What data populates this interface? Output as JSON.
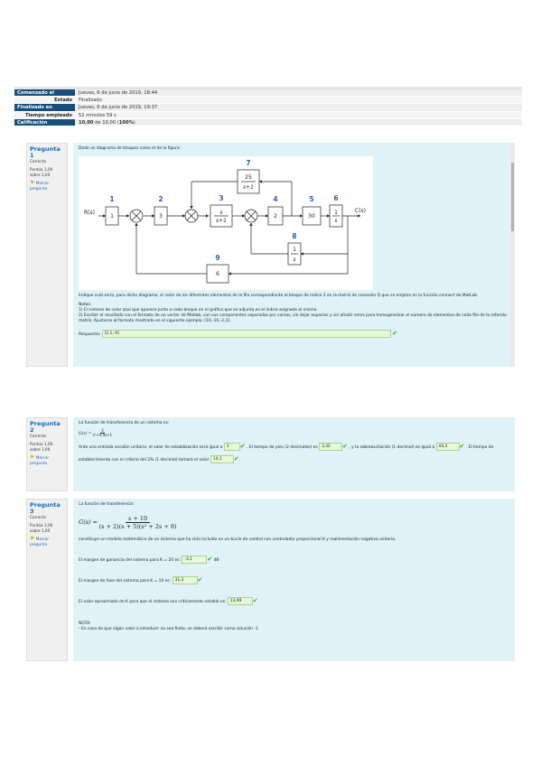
{
  "summary": [
    {
      "label": "Comenzado el",
      "value": "Jueves, 6 de junio de 2019, 18:44"
    },
    {
      "label": "Estado",
      "value": "Finalizado"
    },
    {
      "label": "Finalizado en",
      "value": "Jueves, 6 de junio de 2019, 19:37"
    },
    {
      "label": "Tiempo empleado",
      "value": "52 minutos 59 s"
    },
    {
      "label": "Calificación",
      "value_bold": "10,00",
      "value_mid": " de 10,00 (",
      "value_pct": "100%",
      "value_end": ")"
    }
  ],
  "q1": {
    "label": "Pregunta",
    "num": "1",
    "status": "Correcta",
    "score": "Puntúa 1,00 sobre 1,00",
    "flag": "Marcar pregunta",
    "intro": "Dado un diagrama de bloques como el de la figura:",
    "diagram": {
      "index_labels": [
        "1",
        "2",
        "3",
        "4",
        "5",
        "6",
        "7",
        "8",
        "9"
      ],
      "blocks": {
        "b1": "1",
        "b2": "3",
        "b3_num": "s",
        "b3_den": "s+1",
        "b4": "2",
        "b5": "30",
        "b6_num": "1",
        "b6_den": "s",
        "b7_num": "25",
        "b7_den": "s+1",
        "b8_num": "1",
        "b8_den": "s",
        "b9": "6"
      },
      "input": "R(s)",
      "output": "C(s)"
    },
    "para1": "Indique cuál sería, para dicho diagrama, el valor de los diferentes elementos de la fila correspondiente al bloque de índice 2 en la matriz de conexión Q que se emplea en la función",
    "para1_em": "connect",
    "para1_end": "de MatLab.",
    "notes_title": "Notas:",
    "note1": "1) El número de color azul que aparece junto a cada bloque en el gráfico que se adjunta es el índice asignado al mismo.",
    "note2": "2) Escribir el resultado con el formato de un vector de Matlab, con sus componentes separadas por comas, sin dejar espacios y sin añadir ceros para homogeneizar el número de elementos de cada fila de la referida matriz. Ajustarse al formato mostrado en el siguiente ejemplo: [10,-10,-2,3].",
    "answer_label": "Respuesta:",
    "answer": "[2,1,-9]"
  },
  "q2": {
    "label": "Pregunta",
    "num": "2",
    "status": "Correcta",
    "score": "Puntúa 1,00 sobre 1,00",
    "flag": "Marcar pregunta",
    "intro": "La función de transferencia de un sistema es:",
    "tf_lhs": "G(s) =",
    "tf_num": "3",
    "tf_den": "s²+4.4s+1",
    "t1": "Ante una entrada escalón unitario, el valor de estabilización será igual a",
    "a1": "3",
    "t2": ". El tiempo de pico (2 decimales) es",
    "a2": "3,32",
    "t3": ", y la sobreoscilación (1 decimal) es igual a",
    "a3": "44,3",
    "t4": ". El tiempo de establecimiento con el criterio del 2% (1 decimal) tomará el valor",
    "a4": "14,1",
    "t5": "."
  },
  "q3": {
    "label": "Pregunta",
    "num": "3",
    "status": "Correcta",
    "score": "Puntúa 1,00 sobre 1,00",
    "flag": "Marcar pregunta",
    "intro": "La función de transferencia:",
    "tf_lhs": "G(s) =",
    "tf_num": "s + 10",
    "tf_den": "(s + 2)(s + 5)(s² + 2s + 8)",
    "desc": "constituye un modelo matemático de un sistema que ha sido incluido en un bucle de control con controlador proporcional K y realimentación negativa unitaria.",
    "p1": "El margen de ganancia del sistema para K = 20 es:",
    "a1": "-3,1",
    "u1": "dB",
    "p2": "El margen de fase del sistema para K = 10 es:",
    "a2": "31,3",
    "p3": "El valor aproximado de K para que el sistema sea críticamente estable es:",
    "a3": "13,99",
    "note_title": "NOTA:",
    "note": "- En caso de que algún valor a introducir no sea finito, se deberá escribir como solución -1."
  },
  "colors": {
    "header_blue": "#174f7c",
    "content_bg": "#def2f8",
    "check_green": "#3fa13f",
    "link_blue": "#0f6cbf"
  }
}
